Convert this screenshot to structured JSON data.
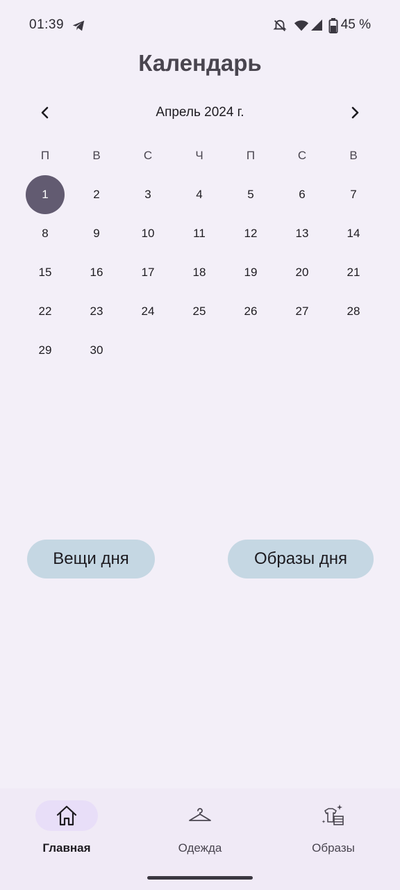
{
  "status_bar": {
    "time": "01:39",
    "battery_text": "45 %"
  },
  "page": {
    "title": "Календарь"
  },
  "calendar": {
    "month_label": "Апрель 2024 г.",
    "weekdays": [
      "П",
      "В",
      "С",
      "Ч",
      "П",
      "С",
      "В"
    ],
    "weeks": [
      [
        "1",
        "2",
        "3",
        "4",
        "5",
        "6",
        "7"
      ],
      [
        "8",
        "9",
        "10",
        "11",
        "12",
        "13",
        "14"
      ],
      [
        "15",
        "16",
        "17",
        "18",
        "19",
        "20",
        "21"
      ],
      [
        "22",
        "23",
        "24",
        "25",
        "26",
        "27",
        "28"
      ],
      [
        "29",
        "30",
        "",
        "",
        "",
        "",
        ""
      ]
    ],
    "selected_day": "1"
  },
  "actions": {
    "items_of_day": "Вещи дня",
    "outfits_of_day": "Образы дня"
  },
  "bottom_nav": {
    "items": [
      {
        "label": "Главная",
        "icon": "home-icon",
        "active": true
      },
      {
        "label": "Одежда",
        "icon": "hanger-icon",
        "active": false
      },
      {
        "label": "Образы",
        "icon": "outfit-icon",
        "active": false
      }
    ]
  },
  "colors": {
    "background": "#f3eff8",
    "selected_day": "#625b71",
    "action_button": "#c5d7e3",
    "nav_active_pill": "#e8def8"
  }
}
